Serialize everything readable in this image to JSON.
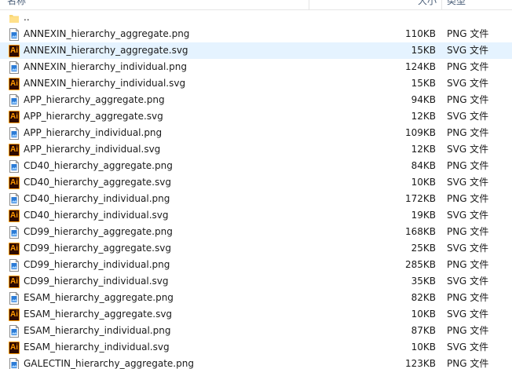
{
  "columns": {
    "name": "名称",
    "size": "大小",
    "type": "类型"
  },
  "parent_row": {
    "label": ".."
  },
  "icons": {
    "png": "image-file-icon",
    "svg": "adobe-illustrator-file-icon",
    "folder": "folder-icon",
    "ai_text": "Ai"
  },
  "colors": {
    "selection": "#e5f3ff",
    "ai_orange": "#ff9a00",
    "ai_background": "#2d0a00"
  },
  "files": [
    {
      "name": "ANNEXIN_hierarchy_aggregate.png",
      "size": "110KB",
      "type": "PNG 文件",
      "kind": "png"
    },
    {
      "name": "ANNEXIN_hierarchy_aggregate.svg",
      "size": "15KB",
      "type": "SVG 文件",
      "kind": "svg",
      "selected": true
    },
    {
      "name": "ANNEXIN_hierarchy_individual.png",
      "size": "124KB",
      "type": "PNG 文件",
      "kind": "png"
    },
    {
      "name": "ANNEXIN_hierarchy_individual.svg",
      "size": "15KB",
      "type": "SVG 文件",
      "kind": "svg"
    },
    {
      "name": "APP_hierarchy_aggregate.png",
      "size": "94KB",
      "type": "PNG 文件",
      "kind": "png"
    },
    {
      "name": "APP_hierarchy_aggregate.svg",
      "size": "12KB",
      "type": "SVG 文件",
      "kind": "svg"
    },
    {
      "name": "APP_hierarchy_individual.png",
      "size": "109KB",
      "type": "PNG 文件",
      "kind": "png"
    },
    {
      "name": "APP_hierarchy_individual.svg",
      "size": "12KB",
      "type": "SVG 文件",
      "kind": "svg"
    },
    {
      "name": "CD40_hierarchy_aggregate.png",
      "size": "84KB",
      "type": "PNG 文件",
      "kind": "png"
    },
    {
      "name": "CD40_hierarchy_aggregate.svg",
      "size": "10KB",
      "type": "SVG 文件",
      "kind": "svg"
    },
    {
      "name": "CD40_hierarchy_individual.png",
      "size": "172KB",
      "type": "PNG 文件",
      "kind": "png"
    },
    {
      "name": "CD40_hierarchy_individual.svg",
      "size": "19KB",
      "type": "SVG 文件",
      "kind": "svg"
    },
    {
      "name": "CD99_hierarchy_aggregate.png",
      "size": "168KB",
      "type": "PNG 文件",
      "kind": "png"
    },
    {
      "name": "CD99_hierarchy_aggregate.svg",
      "size": "25KB",
      "type": "SVG 文件",
      "kind": "svg"
    },
    {
      "name": "CD99_hierarchy_individual.png",
      "size": "285KB",
      "type": "PNG 文件",
      "kind": "png"
    },
    {
      "name": "CD99_hierarchy_individual.svg",
      "size": "35KB",
      "type": "SVG 文件",
      "kind": "svg"
    },
    {
      "name": "ESAM_hierarchy_aggregate.png",
      "size": "82KB",
      "type": "PNG 文件",
      "kind": "png"
    },
    {
      "name": "ESAM_hierarchy_aggregate.svg",
      "size": "10KB",
      "type": "SVG 文件",
      "kind": "svg"
    },
    {
      "name": "ESAM_hierarchy_individual.png",
      "size": "87KB",
      "type": "PNG 文件",
      "kind": "png"
    },
    {
      "name": "ESAM_hierarchy_individual.svg",
      "size": "10KB",
      "type": "SVG 文件",
      "kind": "svg"
    },
    {
      "name": "GALECTIN_hierarchy_aggregate.png",
      "size": "123KB",
      "type": "PNG 文件",
      "kind": "png"
    }
  ]
}
